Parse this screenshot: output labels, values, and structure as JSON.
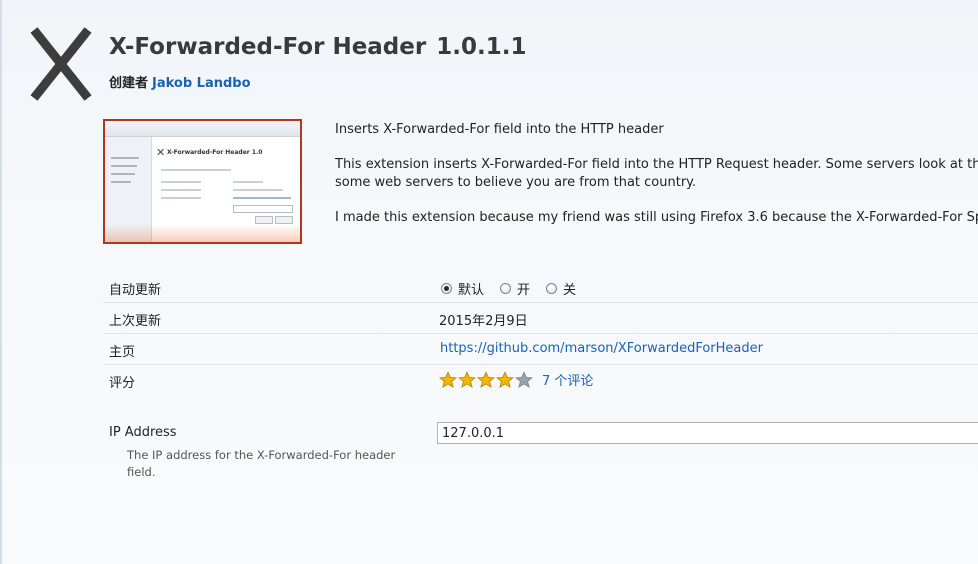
{
  "addon": {
    "icon": "x-letter-icon",
    "name": "X-Forwarded-For Header",
    "version": "1.0.1.1",
    "creator_label": "创建者",
    "creator_name": "Jakob Landbo"
  },
  "screenshot": {
    "title": "X-Forwarded-For Header 1.0"
  },
  "description": {
    "summary": "Inserts X-Forwarded-For field into the HTTP header",
    "body_line1": "This extension inserts X-Forwarded-For field into the HTTP Request header. Some servers look at this f",
    "body_line2": "some web servers to believe you are from that country.",
    "body_line3": "I made this extension because my friend was still using Firefox 3.6 because the X-Forwarded-For Spoo"
  },
  "details": {
    "auto_update": {
      "label": "自动更新",
      "options": [
        "默认",
        "开",
        "关"
      ],
      "selected": "默认"
    },
    "last_updated": {
      "label": "上次更新",
      "value": "2015年2月9日"
    },
    "homepage": {
      "label": "主页",
      "value": "https://github.com/marson/XForwardedForHeader"
    },
    "rating": {
      "label": "评分",
      "stars": 4,
      "max_stars": 5,
      "reviews": "7 个评论"
    }
  },
  "preferences": {
    "ip_address": {
      "label": "IP Address",
      "description": "The IP address for the X-Forwarded-For header field.",
      "value": "127.0.0.1"
    }
  },
  "colors": {
    "link": "#1a62b6",
    "star_filled": "#f2b705",
    "star_empty": "#9aa3ad",
    "screenshot_border": "#b3351c"
  }
}
